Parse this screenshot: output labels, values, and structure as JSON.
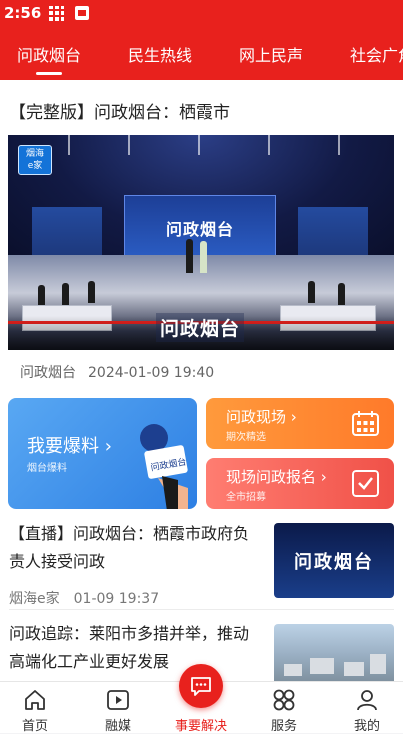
{
  "status_bar": {
    "time": "2:56"
  },
  "tabs": [
    {
      "label": "问政烟台",
      "active": true
    },
    {
      "label": "民生热线"
    },
    {
      "label": "网上民声"
    },
    {
      "label": "社会广角"
    }
  ],
  "feature": {
    "headline": "【完整版】问政烟台：栖霞市",
    "video": {
      "badge_top": "烟海",
      "badge_bottom": "e家",
      "screen_text": "问政烟台",
      "caption": "问政烟台"
    },
    "source": "问政烟台",
    "datetime": "2024-01-09 19:40"
  },
  "cards": {
    "report": {
      "title": "我要爆料 ›",
      "subtitle": "烟台爆料",
      "mic_label": "问政烟台"
    },
    "live": {
      "title": "问政现场 ›",
      "subtitle": "期次精选"
    },
    "signup": {
      "title": "现场问政报名 ›",
      "subtitle": "全市招募"
    }
  },
  "news": [
    {
      "title": "【直播】问政烟台：栖霞市政府负责人接受问政",
      "source": "烟海e家",
      "date": "01-09 19:37",
      "thumb_text": "问政烟台"
    },
    {
      "title": "问政追踪：莱阳市多措并举，推动高端化工产业更好发展"
    }
  ],
  "bottom_nav": [
    {
      "label": "首页",
      "icon": "home-icon"
    },
    {
      "label": "融媒",
      "icon": "play-icon"
    },
    {
      "label": "事要解决",
      "icon": "chat-icon"
    },
    {
      "label": "服务",
      "icon": "grid-icon"
    },
    {
      "label": "我的",
      "icon": "user-icon"
    }
  ],
  "colors": {
    "brand": "#e8211d",
    "card_blue": "#3a8ae8",
    "card_orange": "#ff8a33",
    "card_red": "#f15a50"
  }
}
